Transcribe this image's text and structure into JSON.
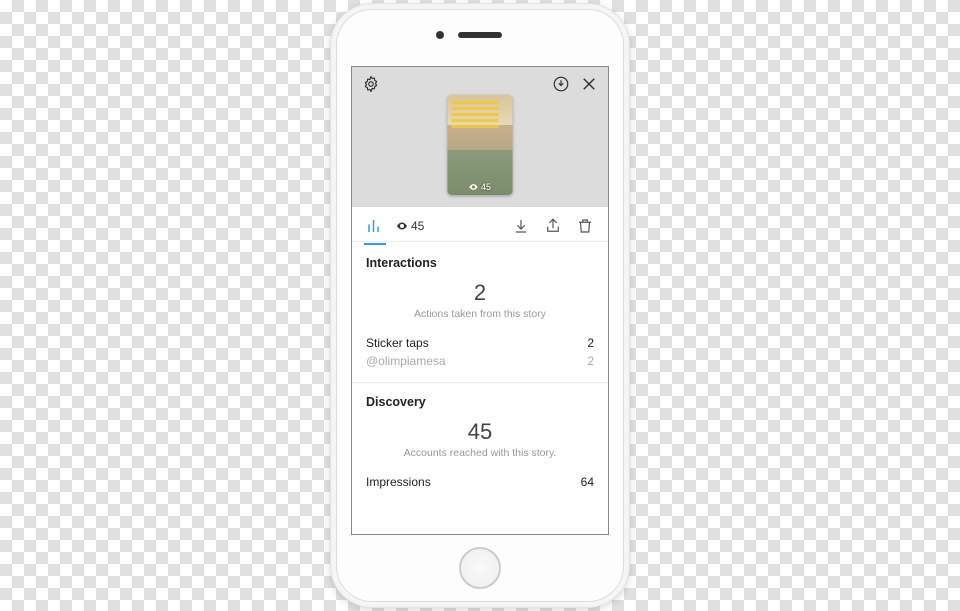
{
  "thumbnail": {
    "views": "45"
  },
  "actionbar": {
    "views": "45"
  },
  "interactions": {
    "title": "Interactions",
    "count": "2",
    "subtitle": "Actions taken from this story",
    "rows": [
      {
        "label": "Sticker taps",
        "value": "2"
      },
      {
        "label": "@olimpiamesa",
        "value": "2"
      }
    ]
  },
  "discovery": {
    "title": "Discovery",
    "count": "45",
    "subtitle": "Accounts reached with this story.",
    "rows": [
      {
        "label": "Impressions",
        "value": "64"
      }
    ]
  }
}
